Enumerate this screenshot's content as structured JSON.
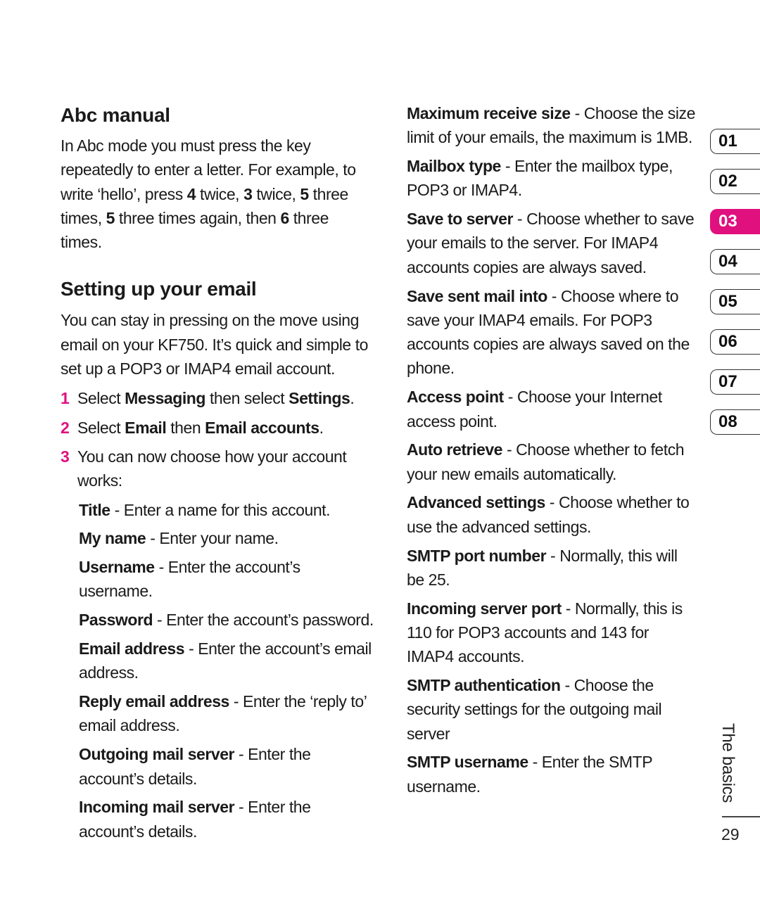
{
  "left": {
    "abc_manual": {
      "heading": "Abc manual",
      "body": [
        {
          "t": "In Abc mode you must press the key repeatedly to enter a letter. For example, to write ‘hello’, press ",
          "b": false
        },
        {
          "t": "4",
          "b": true
        },
        {
          "t": " twice, ",
          "b": false
        },
        {
          "t": "3",
          "b": true
        },
        {
          "t": " twice, ",
          "b": false
        },
        {
          "t": "5",
          "b": true
        },
        {
          "t": " three times, ",
          "b": false
        },
        {
          "t": "5",
          "b": true
        },
        {
          "t": " three times again, then ",
          "b": false
        },
        {
          "t": "6",
          "b": true
        },
        {
          "t": " three times.",
          "b": false
        }
      ]
    },
    "email": {
      "heading": "Setting up your email",
      "intro": "You can stay in pressing on the move using email on your KF750. It’s quick and simple to set up a POP3 or IMAP4 email account.",
      "steps": [
        {
          "num": "1",
          "parts": [
            {
              "t": "Select ",
              "b": false
            },
            {
              "t": "Messaging",
              "b": true
            },
            {
              "t": " then select ",
              "b": false
            },
            {
              "t": "Settings",
              "b": true
            },
            {
              "t": ".",
              "b": false
            }
          ]
        },
        {
          "num": "2",
          "parts": [
            {
              "t": "Select ",
              "b": false
            },
            {
              "t": "Email",
              "b": true
            },
            {
              "t": " then ",
              "b": false
            },
            {
              "t": "Email accounts",
              "b": true
            },
            {
              "t": ".",
              "b": false
            }
          ]
        },
        {
          "num": "3",
          "parts": [
            {
              "t": "You can now choose how your account works:",
              "b": false
            }
          ]
        }
      ],
      "settings": [
        {
          "term": "Title",
          "desc": " - Enter a name for this account."
        },
        {
          "term": "My name",
          "desc": " - Enter your name."
        },
        {
          "term": "Username",
          "desc": " - Enter the account’s username."
        },
        {
          "term": "Password",
          "desc": " - Enter the account’s password."
        },
        {
          "term": "Email address",
          "desc": " - Enter the account’s email address."
        },
        {
          "term": "Reply email address",
          "desc": " - Enter the ‘reply to’ email address."
        },
        {
          "term": "Outgoing mail server",
          "desc": " - Enter the account’s details."
        },
        {
          "term": "Incoming mail server",
          "desc": " - Enter the account’s details."
        }
      ]
    }
  },
  "right": {
    "settings": [
      {
        "term": "Maximum receive size",
        "desc": " - Choose the size limit of your emails, the maximum is 1MB."
      },
      {
        "term": "Mailbox type",
        "desc": " - Enter the mailbox type, POP3 or IMAP4."
      },
      {
        "term": "Save to server",
        "desc": " - Choose whether to save your emails to the server. For IMAP4 accounts copies are always saved."
      },
      {
        "term": "Save sent mail into",
        "desc": " - Choose where to save your IMAP4 emails. For POP3 accounts copies are always saved on the phone."
      },
      {
        "term": "Access point",
        "desc": " - Choose your Internet access point."
      },
      {
        "term": "Auto retrieve",
        "desc": " - Choose whether to fetch your new emails automatically."
      },
      {
        "term": "Advanced settings",
        "desc": " - Choose whether to use the advanced settings."
      },
      {
        "term": "SMTP port number",
        "desc": " - Normally, this will be 25."
      },
      {
        "term": "Incoming server port",
        "desc": " - Normally, this is 110 for POP3 accounts and 143 for IMAP4 accounts."
      },
      {
        "term": "SMTP authentication",
        "desc": " - Choose the security settings for the outgoing mail server"
      },
      {
        "term": "SMTP username",
        "desc": " - Enter the SMTP username."
      }
    ]
  },
  "chapter_tabs": {
    "items": [
      "01",
      "02",
      "03",
      "04",
      "05",
      "06",
      "07",
      "08"
    ],
    "active": "03",
    "accent_color": "#e0107f"
  },
  "footer": {
    "section_label": "The basics",
    "page_number": "29"
  }
}
